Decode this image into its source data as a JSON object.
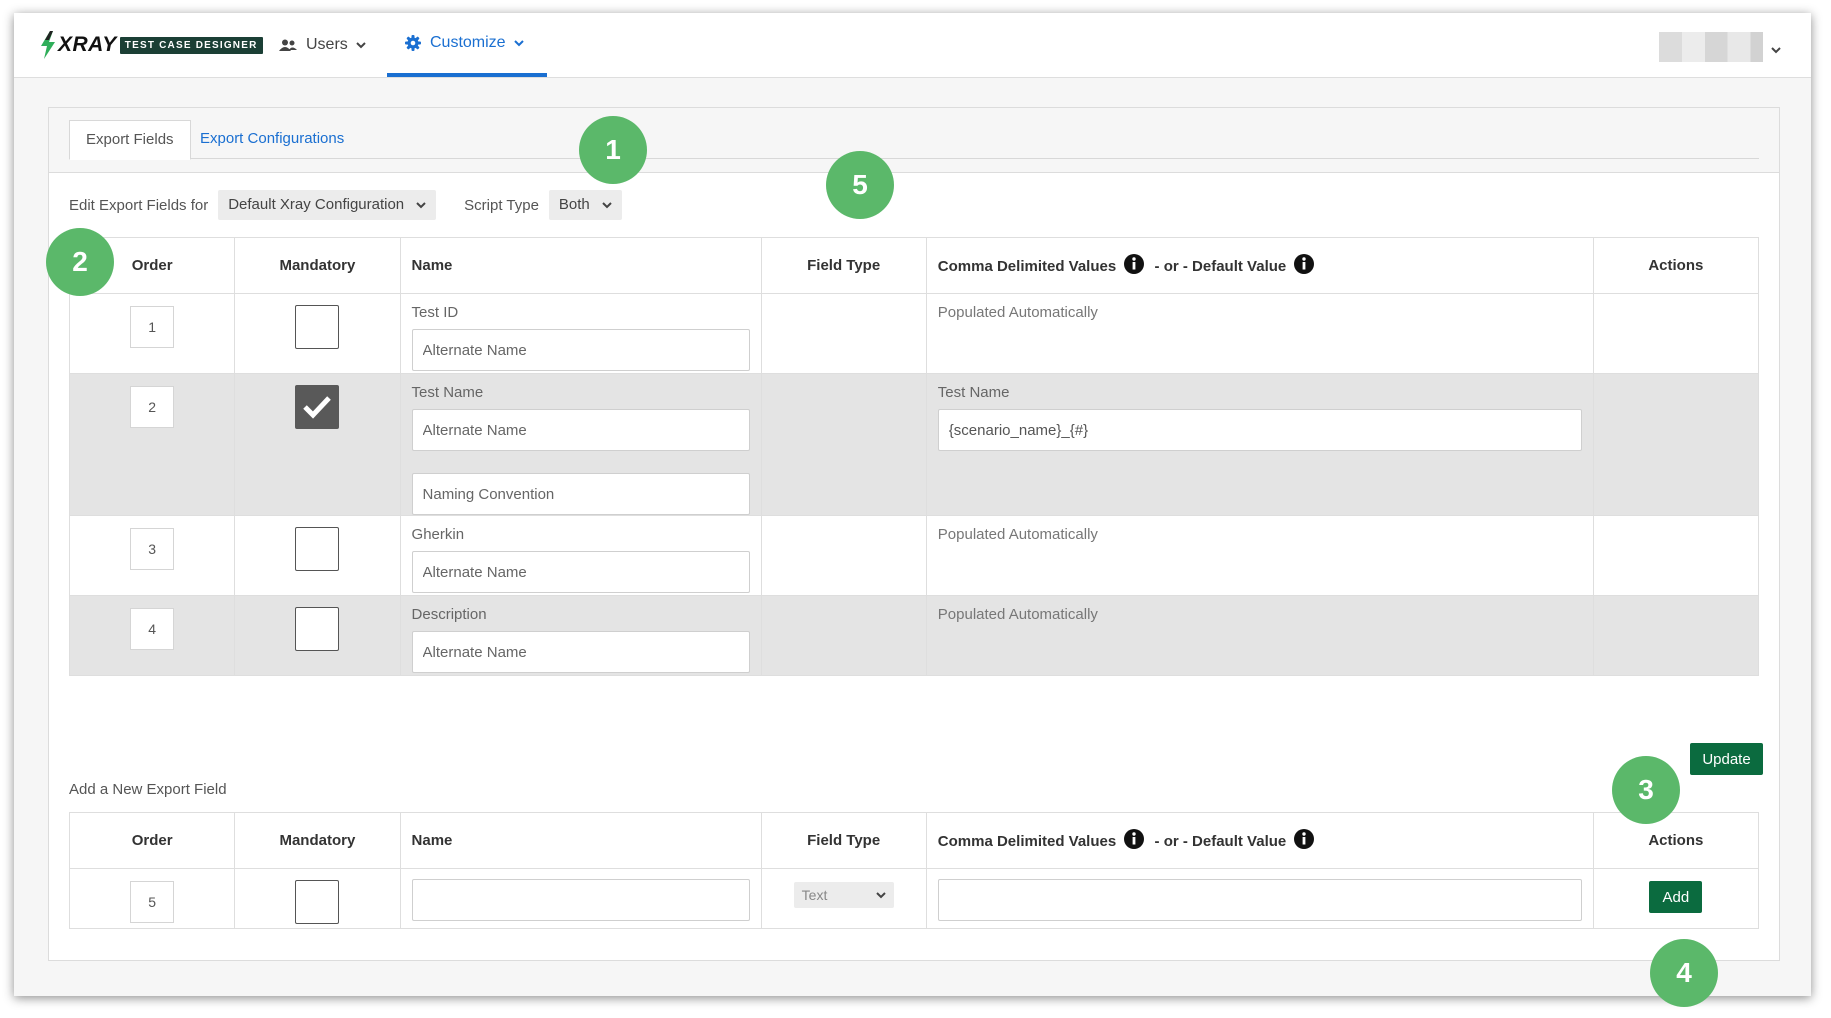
{
  "app": {
    "brand": "XRAY",
    "brand_tag": "TEST CASE DESIGNER"
  },
  "nav": {
    "users": "Users",
    "customize": "Customize"
  },
  "tabs": [
    {
      "label": "Export Fields",
      "active": true
    },
    {
      "label": "Export Configurations",
      "active": false
    }
  ],
  "edit": {
    "label": "Edit Export Fields for",
    "config_value": "Default Xray Configuration",
    "script_type_label": "Script Type",
    "script_type_value": "Both"
  },
  "columns": {
    "order": "Order",
    "mandatory": "Mandatory",
    "name": "Name",
    "field_type": "Field Type",
    "values": "Comma Delimited Values",
    "or_default": "- or - Default Value",
    "actions": "Actions"
  },
  "rows": [
    {
      "order": "1",
      "mandatory": false,
      "name": "Test ID",
      "alt_placeholder": "Alternate Name",
      "values_label": "Populated Automatically"
    },
    {
      "order": "2",
      "mandatory": true,
      "name": "Test Name",
      "alt_placeholder": "Alternate Name",
      "naming_placeholder": "Naming Convention",
      "values_label": "Test Name",
      "default_value": "{scenario_name}_{#}"
    },
    {
      "order": "3",
      "mandatory": false,
      "name": "Gherkin",
      "alt_placeholder": "Alternate Name",
      "values_label": "Populated Automatically"
    },
    {
      "order": "4",
      "mandatory": false,
      "name": "Description",
      "alt_placeholder": "Alternate Name",
      "values_label": "Populated Automatically"
    }
  ],
  "update_button": "Update",
  "new_field": {
    "title": "Add a New Export Field",
    "order": "5",
    "field_type": "Text",
    "add_button": "Add"
  },
  "markers": [
    "1",
    "2",
    "3",
    "4",
    "5"
  ],
  "colors": {
    "accent_blue": "#1a6fd1",
    "button_green": "#0b6b3f",
    "marker_green": "#5bb86a"
  }
}
